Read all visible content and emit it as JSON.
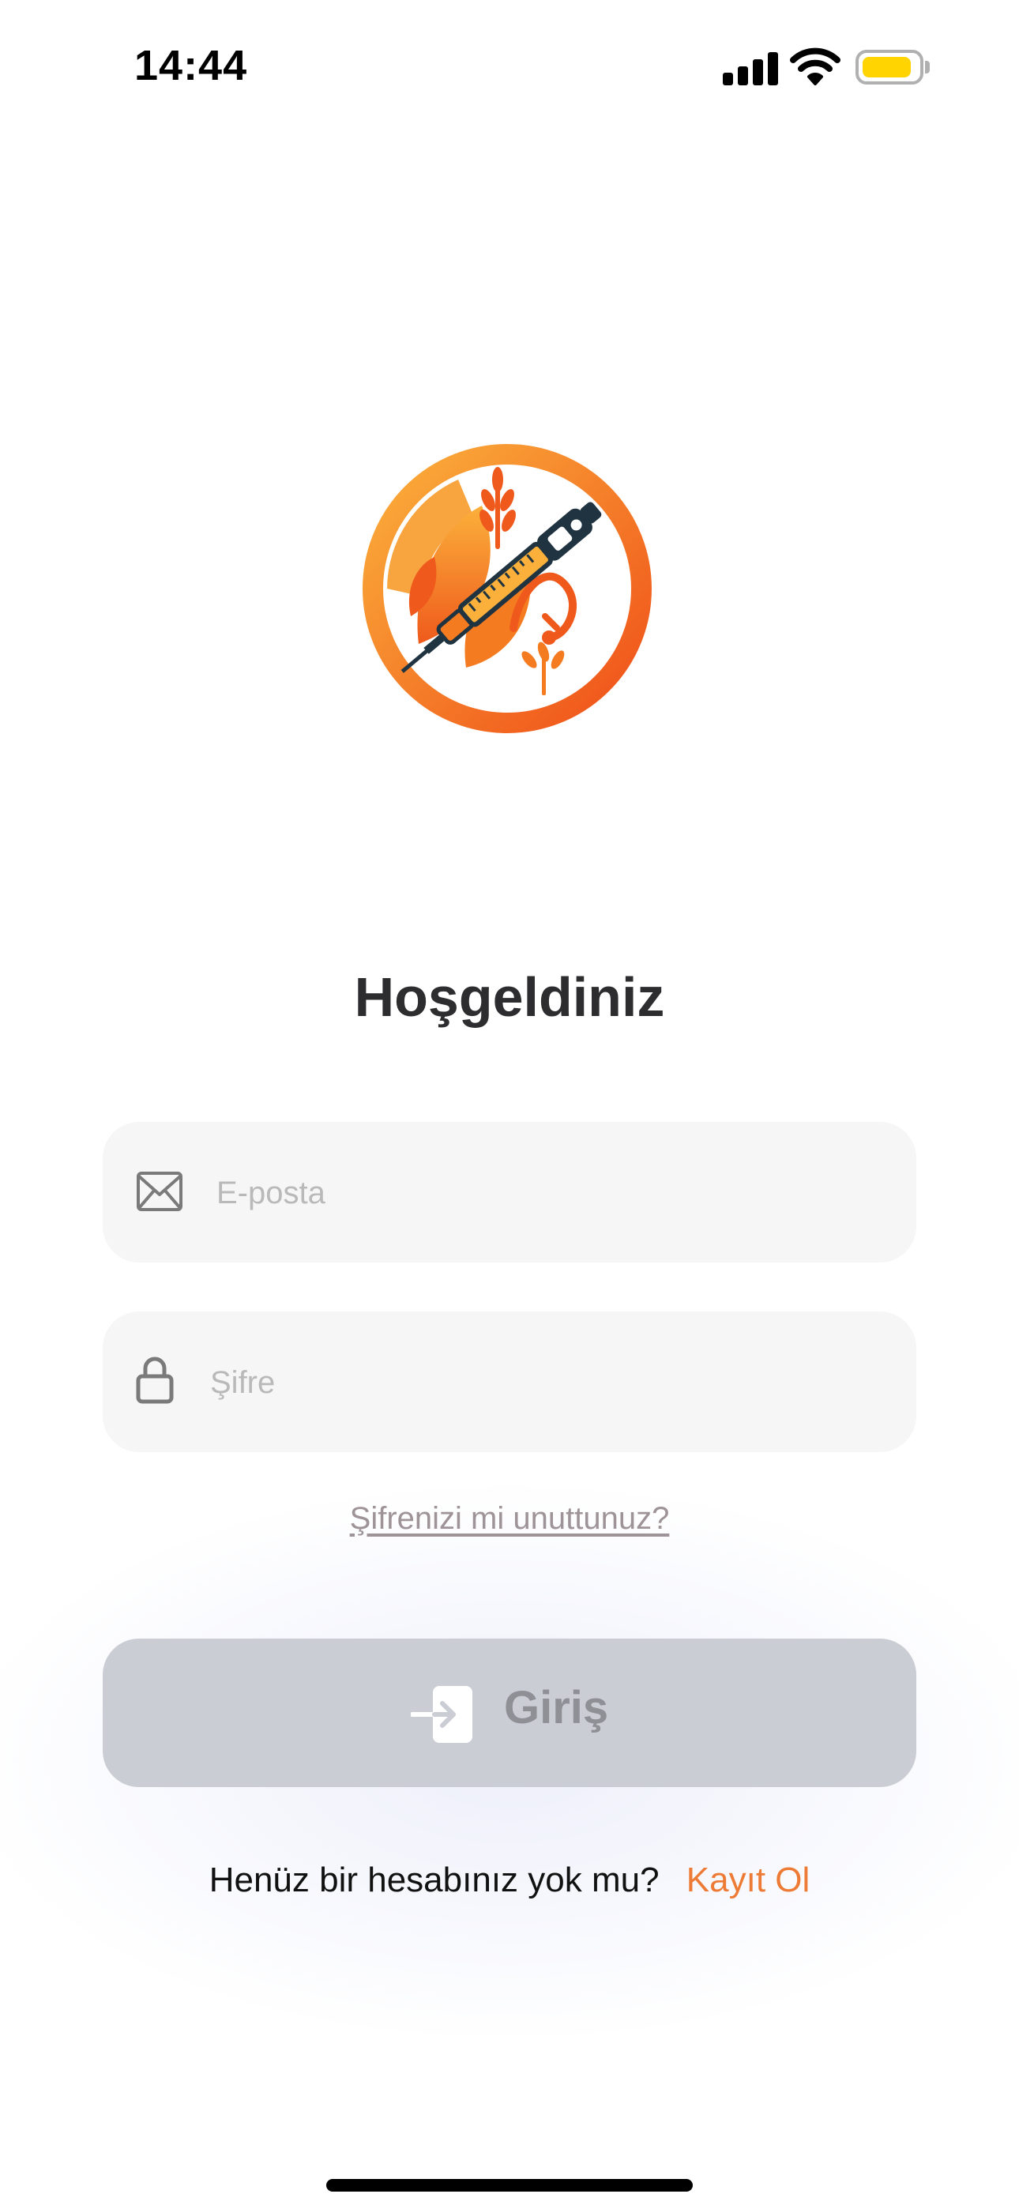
{
  "status_bar": {
    "time": "14:44",
    "signal_icon": "cellular-signal-icon",
    "wifi_icon": "wifi-icon",
    "battery_icon": "battery-icon",
    "battery_level": 0.9,
    "battery_color": "#ffd400"
  },
  "logo": {
    "icon": "diabetes-nutrition-logo",
    "colors": {
      "orange": "#f7941d",
      "deep_orange": "#ef5a1c",
      "dark": "#1f3340"
    }
  },
  "login": {
    "title": "Hoşgeldiniz",
    "email": {
      "placeholder": "E-posta",
      "value": "",
      "icon": "envelope-icon"
    },
    "password": {
      "placeholder": "Şifre",
      "value": "",
      "icon": "lock-icon"
    },
    "forgot_password": "Şifrenizi mi unuttunuz?",
    "submit_label": "Giriş",
    "submit_icon": "sign-in-icon"
  },
  "signup": {
    "prompt": "Henüz bir hesabınız yok mu?",
    "link": "Kayıt Ol"
  },
  "colors": {
    "accent": "#ee7b35",
    "button_disabled": "#cbcdd5",
    "field_background": "#f6f6f6"
  }
}
